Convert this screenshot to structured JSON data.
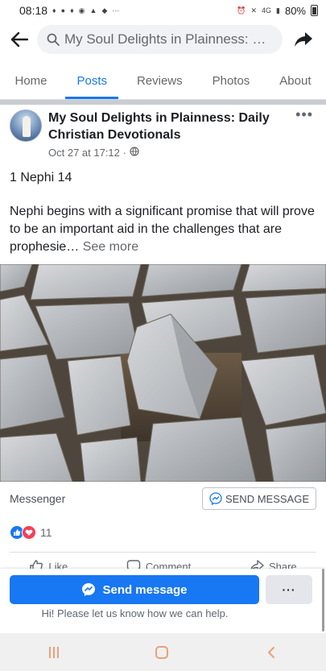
{
  "status_bar": {
    "time": "08:18",
    "network": "4G",
    "battery": "80%"
  },
  "search": {
    "query": "My Soul Delights in Plainness: D..."
  },
  "tabs": [
    {
      "label": "Home",
      "active": false
    },
    {
      "label": "Posts",
      "active": true
    },
    {
      "label": "Reviews",
      "active": false
    },
    {
      "label": "Photos",
      "active": false
    },
    {
      "label": "About",
      "active": false
    }
  ],
  "post": {
    "page_name": "My Soul Delights in Plainness: Daily Christian Devotionals",
    "timestamp": "Oct 27 at 17:12 ·",
    "title_line": "1 Nephi 14",
    "body": "Nephi begins with a significant promise that will prove to be an important aid in the challenges that are prophesie…",
    "see_more": "See more",
    "messenger_label": "Messenger",
    "send_message_outline": "SEND MESSAGE",
    "reaction_count": "11",
    "actions": {
      "like": "Like",
      "comment": "Comment",
      "share": "Share"
    }
  },
  "bottom_panel": {
    "send_message": "Send message",
    "more": "···",
    "help": "Hi! Please let us know how we can help."
  },
  "colors": {
    "accent": "#1877f2",
    "love": "#f33e58",
    "nav_icons": "#e9a07a"
  }
}
